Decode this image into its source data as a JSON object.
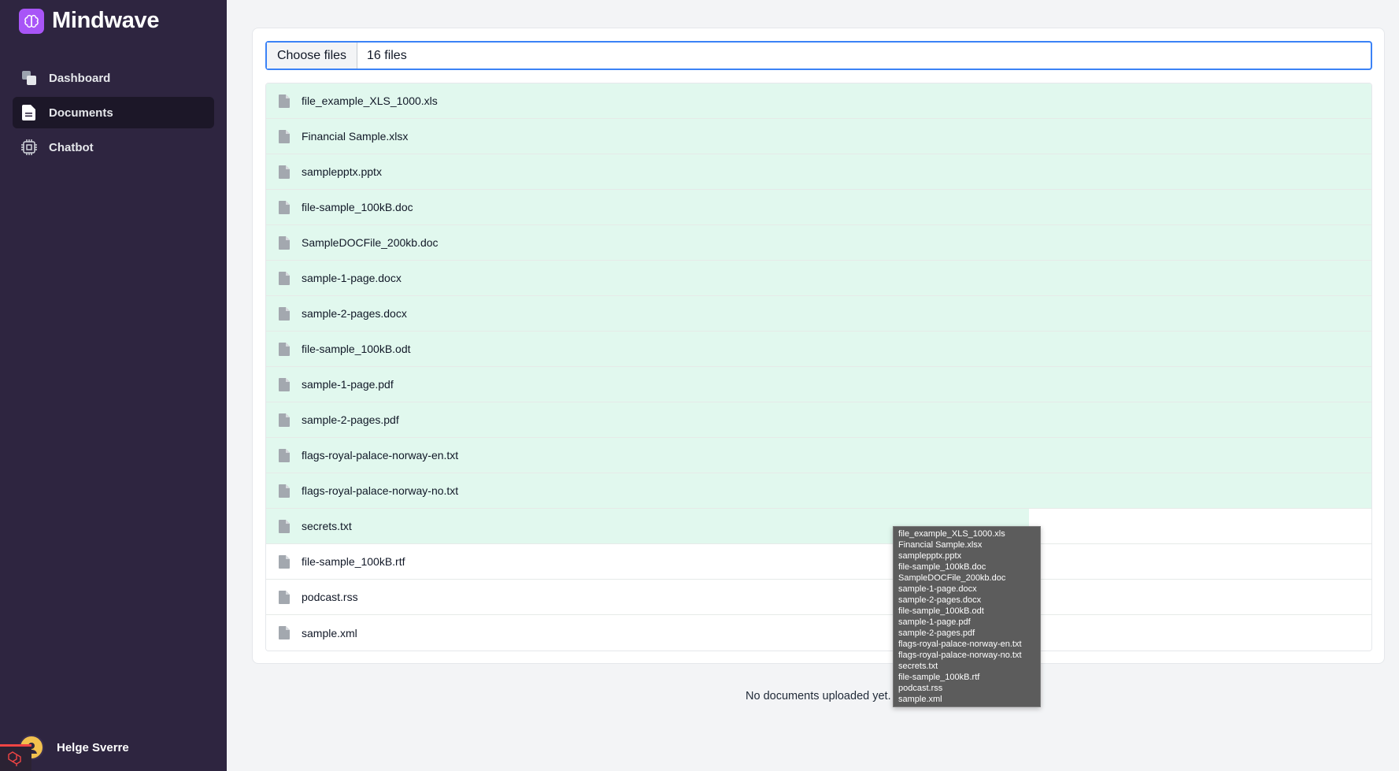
{
  "app": {
    "name": "Mindwave"
  },
  "sidebar": {
    "items": [
      {
        "label": "Dashboard",
        "icon": "dashboard-icon",
        "active": false
      },
      {
        "label": "Documents",
        "icon": "document-icon",
        "active": true
      },
      {
        "label": "Chatbot",
        "icon": "chip-icon",
        "active": false
      }
    ],
    "user": {
      "name": "Helge Sverre"
    }
  },
  "upload": {
    "choose_label": "Choose files",
    "file_count": "16 files"
  },
  "files": [
    {
      "name": "file_example_XLS_1000.xls",
      "progress": 1.0
    },
    {
      "name": "Financial Sample.xlsx",
      "progress": 1.0
    },
    {
      "name": "samplepptx.pptx",
      "progress": 1.0
    },
    {
      "name": "file-sample_100kB.doc",
      "progress": 1.0
    },
    {
      "name": "SampleDOCFile_200kb.doc",
      "progress": 1.0
    },
    {
      "name": "sample-1-page.docx",
      "progress": 1.0
    },
    {
      "name": "sample-2-pages.docx",
      "progress": 1.0
    },
    {
      "name": "file-sample_100kB.odt",
      "progress": 1.0
    },
    {
      "name": "sample-1-page.pdf",
      "progress": 1.0
    },
    {
      "name": "sample-2-pages.pdf",
      "progress": 1.0
    },
    {
      "name": "flags-royal-palace-norway-en.txt",
      "progress": 1.0
    },
    {
      "name": "flags-royal-palace-norway-no.txt",
      "progress": 1.0
    },
    {
      "name": "secrets.txt",
      "progress": 0.69
    },
    {
      "name": "file-sample_100kB.rtf",
      "progress": 0
    },
    {
      "name": "podcast.rss",
      "progress": 0
    },
    {
      "name": "sample.xml",
      "progress": 0
    }
  ],
  "empty_message": "No documents uploaded yet.",
  "tooltip": {
    "lines": [
      "file_example_XLS_1000.xls",
      "Financial Sample.xlsx",
      "samplepptx.pptx",
      "file-sample_100kB.doc",
      "SampleDOCFile_200kb.doc",
      "sample-1-page.docx",
      "sample-2-pages.docx",
      "file-sample_100kB.odt",
      "sample-1-page.pdf",
      "sample-2-pages.pdf",
      "flags-royal-palace-norway-en.txt",
      "flags-royal-palace-norway-no.txt",
      "secrets.txt",
      "file-sample_100kB.rtf",
      "podcast.rss",
      "sample.xml"
    ]
  },
  "colors": {
    "sidebar_bg": "#2e2540",
    "accent": "#a855f7",
    "progress_fill": "#e1f8ee",
    "focus_border": "#3b82f6"
  }
}
